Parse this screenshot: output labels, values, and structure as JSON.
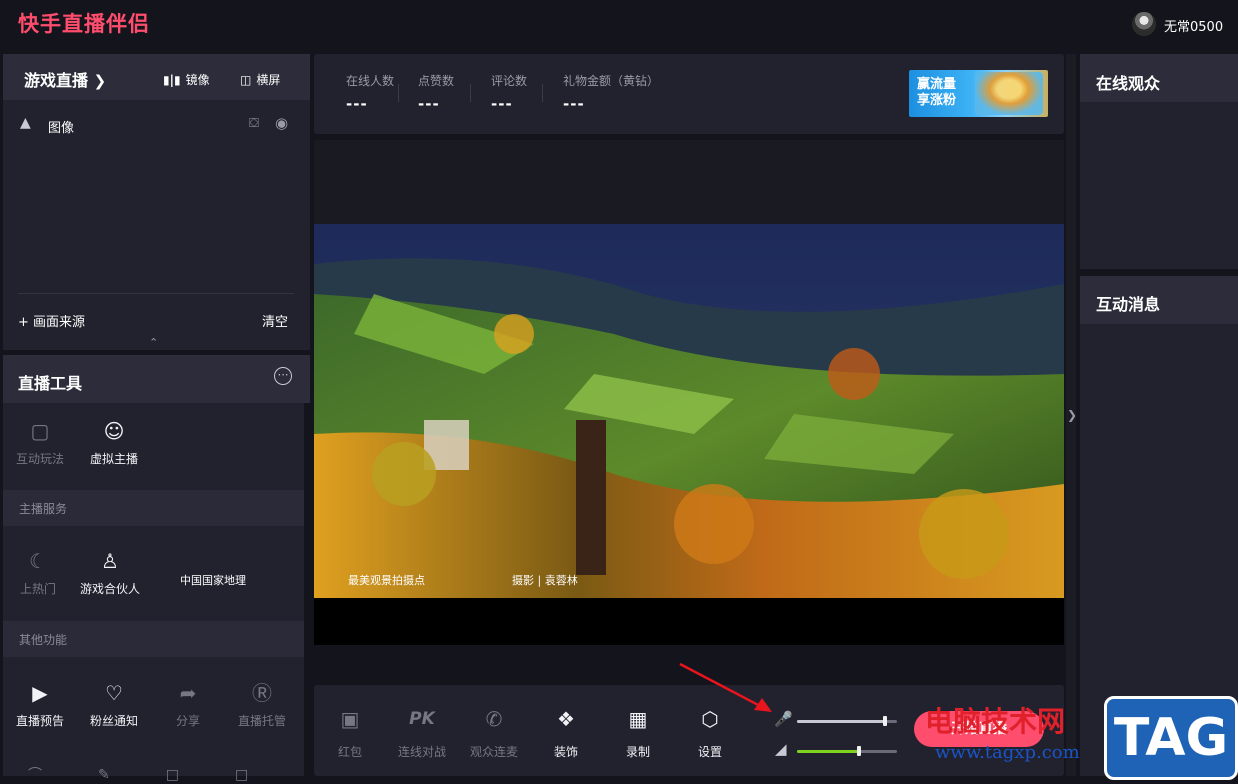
{
  "app": {
    "title": "快手直播伴侣",
    "username": "无常0500"
  },
  "source_panel": {
    "title": "游戏直播",
    "mirror_label": "镜像",
    "landscape_label": "横屏",
    "items": [
      {
        "label": "图像"
      }
    ],
    "add_source_label": "画面来源",
    "clear_label": "清空"
  },
  "tools_panel": {
    "title": "直播工具",
    "row1": [
      {
        "label": "互动玩法",
        "icon": "gamepad-icon"
      },
      {
        "label": "虚拟主播",
        "icon": "face-scan-icon"
      }
    ],
    "section_host": "主播服务",
    "row2": [
      {
        "label": "上热门",
        "icon": "fire-moon-icon"
      },
      {
        "label": "游戏合伙人",
        "icon": "user-icon"
      }
    ],
    "section_other": "其他功能",
    "row3": [
      {
        "label": "直播预告",
        "icon": "calendar-play-icon"
      },
      {
        "label": "粉丝通知",
        "icon": "heart-chat-icon"
      },
      {
        "label": "分享",
        "icon": "share-icon"
      },
      {
        "label": "直播托管",
        "icon": "hosting-icon"
      }
    ]
  },
  "stats": {
    "items": [
      {
        "label": "在线人数",
        "value": "---"
      },
      {
        "label": "点赞数",
        "value": "---"
      },
      {
        "label": "评论数",
        "value": "---"
      },
      {
        "label": "礼物金额（黄钻）",
        "value": "---"
      }
    ],
    "banner_text_line1": "赢流量",
    "banner_text_line2": "享涨粉"
  },
  "preview": {
    "watermark_left": "中国国家地理",
    "watermark_mid": "最美观景拍摄点",
    "watermark_right": "摄影 | 袁蓉林"
  },
  "right_panels": {
    "audience_title": "在线观众",
    "messages_title": "互动消息"
  },
  "bottom_bar": {
    "tools": [
      {
        "label": "红包",
        "icon": "red-packet-icon"
      },
      {
        "label": "连线对战",
        "icon": "pk-icon"
      },
      {
        "label": "观众连麦",
        "icon": "phone-link-icon"
      },
      {
        "label": "装饰",
        "icon": "puzzle-icon"
      },
      {
        "label": "录制",
        "icon": "video-record-icon"
      },
      {
        "label": "设置",
        "icon": "settings-icon"
      }
    ],
    "pk_glyph": "PK",
    "start_label": "开始直播",
    "mic_level": 0.88,
    "speaker_level": 0.62
  },
  "overlay": {
    "site_name": "电脑技术网",
    "site_url": "www.tagxp.com",
    "tag": "TAG"
  },
  "colors": {
    "brand": "#ff4d6d",
    "accent_green": "#7ed321",
    "panel": "#22222e"
  }
}
